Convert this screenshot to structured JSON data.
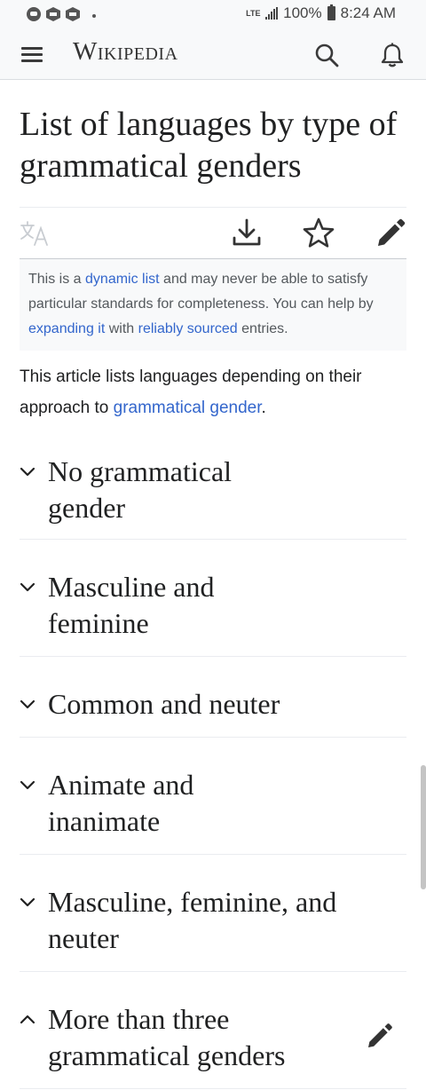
{
  "status_bar": {
    "network": "LTE",
    "battery": "100%",
    "time": "8:24 AM"
  },
  "header": {
    "wordmark": "Wikipedia",
    "icons": [
      "menu-icon",
      "search-icon",
      "bell-icon"
    ]
  },
  "page": {
    "title": "List of languages by type of grammatical genders"
  },
  "page_actions": {
    "icons": [
      "language-icon",
      "download-icon",
      "star-icon",
      "edit-icon"
    ]
  },
  "ambox": {
    "text_1": "This is a ",
    "link_1": "dynamic list",
    "text_2": " and may never be able to satisfy particular standards for completeness. You can help by ",
    "link_2": "expanding it",
    "text_3": " with ",
    "link_3": "reliably sourced",
    "text_4": " entries."
  },
  "lead": {
    "text_1": "This article lists languages depending on their approach to ",
    "link_1": "grammatical gender",
    "text_2": "."
  },
  "sections": [
    {
      "title": "No grammatical gender",
      "expanded": false
    },
    {
      "title": "Masculine and feminine",
      "expanded": false
    },
    {
      "title": "Common and neuter",
      "expanded": false
    },
    {
      "title": "Animate and inanimate",
      "expanded": false
    },
    {
      "title": "Masculine, feminine, and neuter",
      "expanded": false
    },
    {
      "title": "More than three grammatical genders",
      "expanded": true
    }
  ],
  "colors": {
    "link": "#3366cc",
    "text": "#202122",
    "chrome": "#f8f9fa"
  }
}
